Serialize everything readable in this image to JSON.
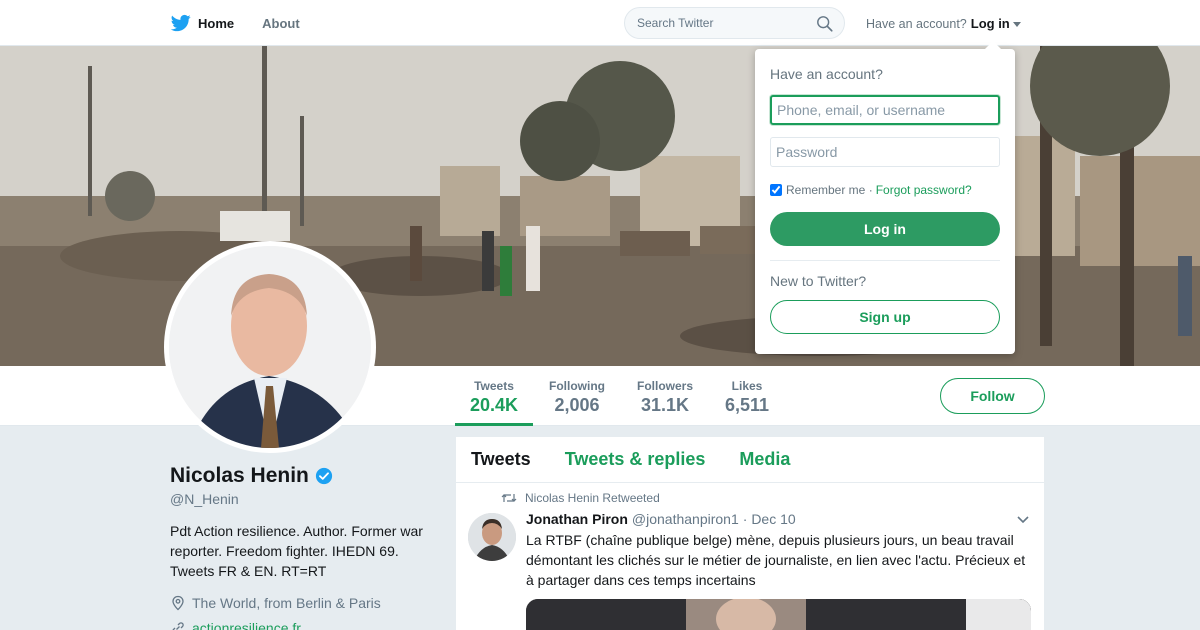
{
  "colors": {
    "accent": "#1b9d5b",
    "text": "#14171a",
    "muted": "#657786",
    "bg": "#e6ecf0"
  },
  "nav": {
    "home_label": "Home",
    "about_label": "About",
    "search_placeholder": "Search Twitter",
    "account_prompt": "Have an account?",
    "login_label": "Log in"
  },
  "profile": {
    "name": "Nicolas Henin",
    "handle": "@N_Henin",
    "bio": "Pdt Action resilience. Author. Former war reporter. Freedom fighter. IHEDN 69. Tweets FR & EN. RT=RT",
    "location": "The World, from Berlin & Paris",
    "website": "actionresilience.fr"
  },
  "stats": [
    {
      "label": "Tweets",
      "value": "20.4K"
    },
    {
      "label": "Following",
      "value": "2,006"
    },
    {
      "label": "Followers",
      "value": "31.1K"
    },
    {
      "label": "Likes",
      "value": "6,511"
    }
  ],
  "follow_label": "Follow",
  "timeline": {
    "tabs": [
      "Tweets",
      "Tweets & replies",
      "Media"
    ],
    "retweet_note": "Nicolas Henin Retweeted",
    "tweet": {
      "author": "Jonathan Piron",
      "handle": "@jonathanpiron1",
      "date": "· Dec 10",
      "text": "La RTBF (chaîne publique belge) mène, depuis plusieurs jours, un beau travail démontant les clichés sur le métier de journaliste, en lien avec l'actu. Précieux et à partager dans ces temps incertains"
    }
  },
  "login_dropdown": {
    "title": "Have an account?",
    "username_placeholder": "Phone, email, or username",
    "password_placeholder": "Password",
    "remember_label": "Remember me ·",
    "forgot_label": "Forgot password?",
    "login_button": "Log in",
    "new_prompt": "New to Twitter?",
    "signup_button": "Sign up"
  }
}
